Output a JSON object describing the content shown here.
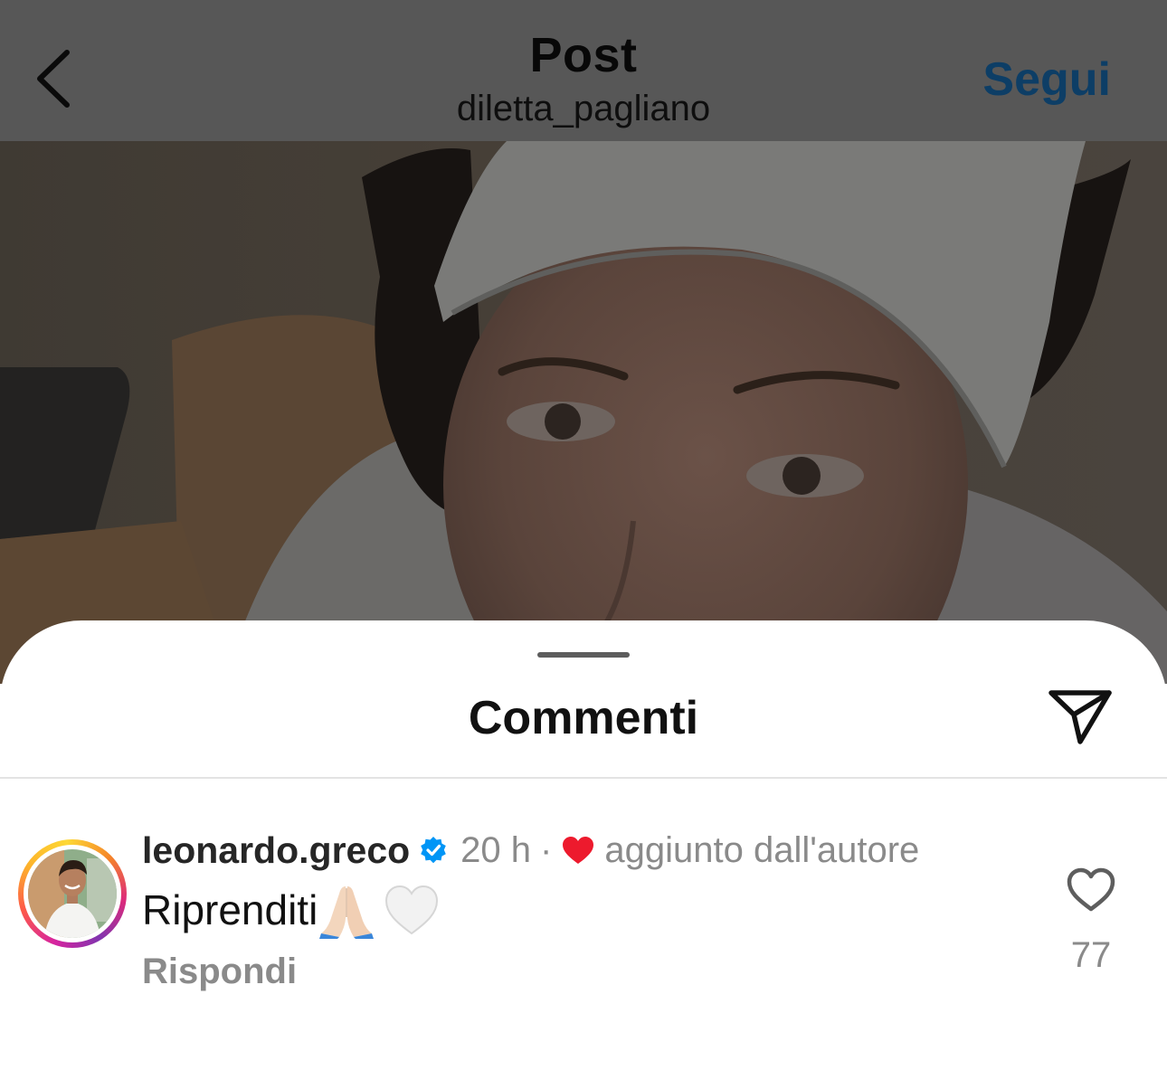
{
  "header": {
    "title": "Post",
    "subtitle": "diletta_pagliano",
    "follow_label": "Segui",
    "back_icon": "chevron-left-icon"
  },
  "photo": {
    "description_icon": "post-photo"
  },
  "sheet": {
    "title": "Commenti",
    "share_icon": "send-icon"
  },
  "comment": {
    "username": "leonardo.greco",
    "verified": true,
    "time": "20 h",
    "separator": "·",
    "author_like_label": "aggiunto dall'autore",
    "text": "Riprenditi",
    "emojis": [
      "folded-hands-emoji",
      "white-heart-emoji"
    ],
    "reply_label": "Rispondi",
    "like_count": "77"
  },
  "colors": {
    "follow": "#0d3e66",
    "verified": "#0095f6",
    "heart": "#ed1a2d",
    "muted_text": "#8a8a8a"
  }
}
